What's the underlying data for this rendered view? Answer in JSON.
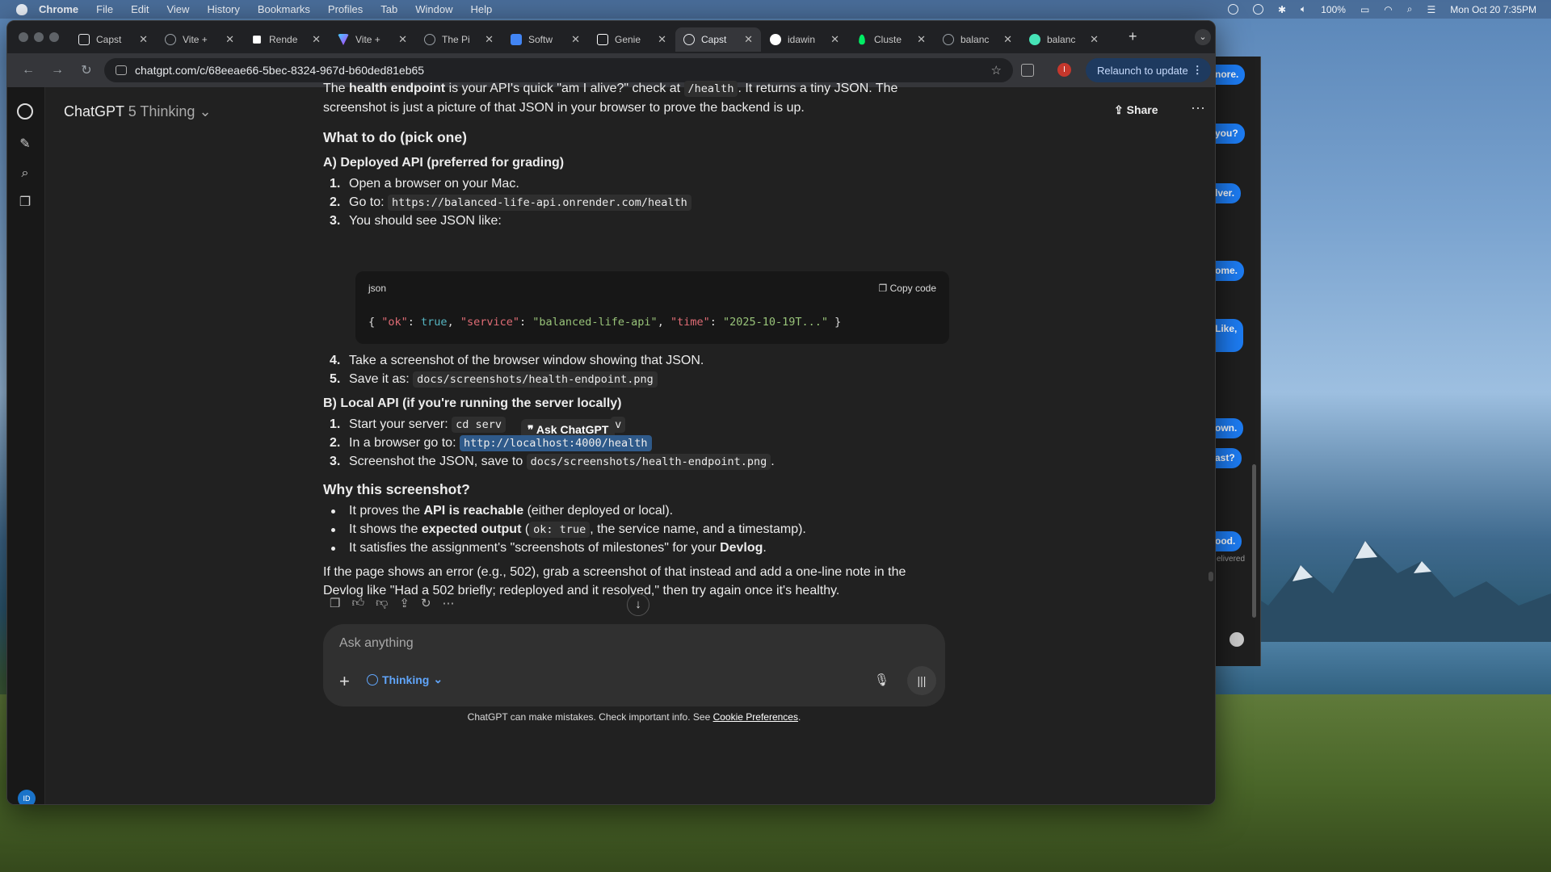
{
  "menubar": {
    "items": [
      "Chrome",
      "File",
      "Edit",
      "View",
      "History",
      "Bookmarks",
      "Profiles",
      "Tab",
      "Window",
      "Help"
    ],
    "battery": "100%",
    "clock": "Mon Oct 20  7:35PM"
  },
  "tabs": [
    {
      "label": "Capst",
      "icon": "capstone-icon",
      "color": "#e8eaed"
    },
    {
      "label": "Vite +",
      "icon": "globe-icon",
      "color": "#9aa0a6"
    },
    {
      "label": "Rende",
      "icon": "render-icon",
      "color": "#ffffff"
    },
    {
      "label": "Vite +",
      "icon": "vite-icon",
      "color": "#bd34fe"
    },
    {
      "label": "The Pi",
      "icon": "globe-icon",
      "color": "#9aa0a6"
    },
    {
      "label": "Softw",
      "icon": "docs-icon",
      "color": "#4285f4"
    },
    {
      "label": "Genie",
      "icon": "genie-icon",
      "color": "#ffffff"
    },
    {
      "label": "Capst",
      "icon": "chatgpt-icon",
      "color": "#e8eaed",
      "active": true
    },
    {
      "label": "idawin",
      "icon": "github-icon",
      "color": "#ffffff"
    },
    {
      "label": "Cluste",
      "icon": "mongodb-icon",
      "color": "#00ed64"
    },
    {
      "label": "balanc",
      "icon": "globe-icon",
      "color": "#9aa0a6"
    },
    {
      "label": "balanc",
      "icon": "render-icon",
      "color": "#46e3b7"
    }
  ],
  "toolbar": {
    "url": "chatgpt.com/c/68eeae66-5bec-8324-967d-b60ded81eb65",
    "relaunch_label": "Relaunch to update",
    "profile_initial": "I"
  },
  "header": {
    "model_name": "ChatGPT",
    "model_variant": "5 Thinking",
    "share_label": "Share"
  },
  "message": {
    "intro_line1_a": "The ",
    "intro_line1_b": "health endpoint",
    "intro_line1_c": " is your API's quick \"am I alive?\" check at ",
    "intro_line1_code": "/health",
    "intro_line1_d": ". It returns a tiny JSON. The",
    "intro_line2": "screenshot is just a picture of that JSON in your browser to prove the backend is up.",
    "what_to_do": "What to do (pick one)",
    "section_a": "A) Deployed API (preferred for grading)",
    "a_steps": {
      "s1": "Open a browser on your Mac.",
      "s2": "Go to: ",
      "s2_code": "https://balanced-life-api.onrender.com/health",
      "s3": "You should see JSON like:",
      "s4": "Take a screenshot of the browser window showing that JSON.",
      "s5": "Save it as: ",
      "s5_code": "docs/screenshots/health-endpoint.png"
    },
    "code": {
      "lang": "json",
      "copy_label": "Copy code",
      "brace_open": "{ ",
      "k1": "\"ok\"",
      "v1": "true",
      "k2": "\"service\"",
      "v2": "\"balanced-life-api\"",
      "k3": "\"time\"",
      "v3": "\"2025-10-19T...\"",
      "brace_close": " }"
    },
    "section_b": "B) Local API (if you're running the server locally)",
    "b_steps": {
      "s1": "Start your server: ",
      "s1_code": "cd serv",
      "s1_code_tail": "v",
      "ask_popup": "Ask ChatGPT",
      "s2": "In a browser go to: ",
      "s2_code": "http://localhost:4000/health",
      "s3": "Screenshot the JSON, save to ",
      "s3_code": "docs/screenshots/health-endpoint.png",
      "s3_end": "."
    },
    "why": "Why this screenshot?",
    "bullets": {
      "b1_a": "It proves the ",
      "b1_b": "API is reachable",
      "b1_c": " (either deployed or local).",
      "b2_a": "It shows the ",
      "b2_b": "expected output",
      "b2_c": " (",
      "b2_code": "ok: true",
      "b2_d": ", the service name, and a timestamp).",
      "b3_a": "It satisfies the assignment's \"screenshots of milestones\" for your ",
      "b3_b": "Devlog",
      "b3_c": "."
    },
    "closing_1": "If the page shows an error (e.g., 502), grab a screenshot of that instead and add a one-line note in the",
    "closing_2": "Devlog like \"Had a 502 briefly; redeployed and it resolved,\" then try again once it's healthy."
  },
  "composer": {
    "placeholder": "Ask anything",
    "thinking_label": "Thinking"
  },
  "disclaimer": {
    "text": "ChatGPT can make mistakes. Check important info. See ",
    "link": "Cookie Preferences",
    "end": "."
  },
  "rail": {
    "avatar_initials": "ID"
  },
  "background_messages": [
    "nore.",
    "you?",
    "lver.",
    "ome.",
    "Like,",
    "own.",
    "ast?",
    "ood.",
    "elivered"
  ]
}
